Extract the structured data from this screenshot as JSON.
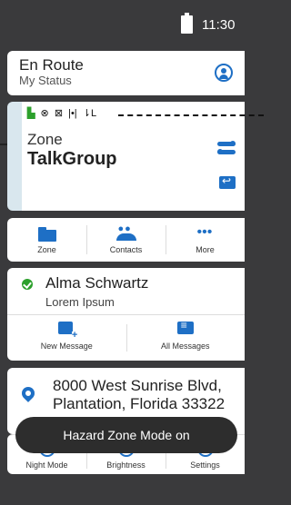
{
  "status_bar": {
    "time": "11:30"
  },
  "status_card": {
    "title": "En Route",
    "subtitle": "My Status"
  },
  "zone_card": {
    "indicators": [
      "▙",
      "⊗",
      "⊠",
      "|•|",
      "⇂L"
    ],
    "zone": "Zone",
    "talkgroup": "TalkGroup"
  },
  "quick_actions": [
    {
      "label": "Zone",
      "icon": "folder-icon"
    },
    {
      "label": "Contacts",
      "icon": "contacts-icon"
    },
    {
      "label": "More",
      "icon": "more-icon"
    }
  ],
  "contact_card": {
    "name": "Alma Schwartz",
    "subtitle": "Lorem Ipsum",
    "new_message": "New Message",
    "all_messages": "All Messages"
  },
  "location_card": {
    "line1": "8000 West Sunrise Blvd,",
    "line2": "Plantation, Florida 33322"
  },
  "bottom_bar": [
    {
      "label": "Night Mode",
      "icon": "night-mode-icon"
    },
    {
      "label": "Brightness",
      "icon": "brightness-icon"
    },
    {
      "label": "Settings",
      "icon": "settings-icon"
    }
  ],
  "toast": {
    "text": "Hazard Zone Mode on"
  },
  "colors": {
    "accent": "#1e6fc5",
    "background": "#3a3a3c",
    "ok": "#2ca02c"
  }
}
